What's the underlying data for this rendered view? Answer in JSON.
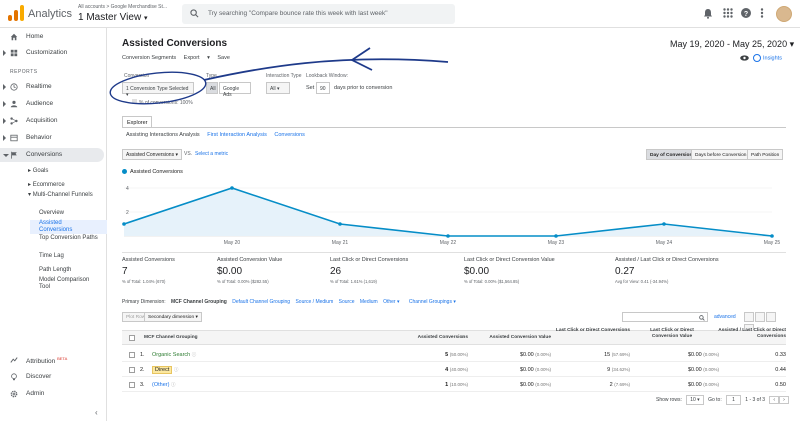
{
  "header": {
    "app_title": "Analytics",
    "account_path": "All accounts > Google Merchandise St...",
    "view_name": "1 Master View",
    "search_placeholder": "Try searching \"Compare bounce rate this week with last week\"",
    "logo_colors": [
      "#f9ab00",
      "#e37400",
      "#e37400"
    ]
  },
  "sidebar": {
    "items": [
      {
        "label": "Home",
        "icon": "home-icon"
      },
      {
        "label": "Customization",
        "icon": "grid-icon"
      },
      {
        "label": "Realtime",
        "icon": "clock-icon"
      },
      {
        "label": "Audience",
        "icon": "person-icon"
      },
      {
        "label": "Acquisition",
        "icon": "acquisition-icon"
      },
      {
        "label": "Behavior",
        "icon": "behavior-icon"
      },
      {
        "label": "Conversions",
        "icon": "flag-icon"
      }
    ],
    "reports_label": "REPORTS",
    "conversions_sub": {
      "goals": "Goals",
      "ecommerce": "Ecommerce",
      "mcf": "Multi-Channel Funnels",
      "overview": "Overview",
      "assisted": "Assisted Conversions",
      "top_paths": "Top Conversion Paths",
      "time_lag": "Time Lag",
      "path_length": "Path Length",
      "model_comp": "Model Comparison Tool"
    },
    "bottom": [
      {
        "label": "Attribution",
        "badge": "BETA",
        "icon": "attribution-icon"
      },
      {
        "label": "Discover",
        "icon": "bulb-icon"
      },
      {
        "label": "Admin",
        "icon": "gear-icon"
      }
    ]
  },
  "main": {
    "title": "Assisted Conversions",
    "date_range": "May 19, 2020 - May 25, 2020",
    "toolbar": [
      "Conversion Segments",
      "Export",
      "Save"
    ],
    "insights_label": "Insights",
    "filters": {
      "conversion_label": "Conversion",
      "conversion_value": "1 Conversion Type Selected",
      "pct_conv_label": "% of conversions: 100%",
      "type_label": "Type",
      "type_all": "All",
      "type_ads": "Google Ads",
      "interaction_label": "Interaction Type",
      "interaction_value": "All",
      "lookback_label": "Lookback Window:",
      "lookback_set": "Set",
      "lookback_days": "90",
      "lookback_suffix": "days prior to conversion"
    },
    "explorer_tab": "Explorer",
    "subtabs": [
      "Assisting Interactions Analysis",
      "First Interaction Analysis",
      "Conversions"
    ],
    "metric_selector": "Assisted Conversions",
    "vs": "VS.",
    "select_metric": "Select a metric",
    "segment_buttons": [
      "Day of Conversion",
      "Days before Conversion",
      "Path Position"
    ]
  },
  "chart_data": {
    "type": "line",
    "series": [
      {
        "name": "Assisted Conversions",
        "values": [
          1,
          4,
          1,
          0,
          0,
          1,
          0
        ]
      }
    ],
    "categories": [
      "",
      "May 20",
      "May 21",
      "May 22",
      "May 23",
      "May 24",
      "May 25"
    ],
    "yticks": [
      "4",
      "2"
    ],
    "ylim": [
      0,
      4.5
    ],
    "color": "#058dc7"
  },
  "stats": [
    {
      "title": "Assisted Conversions",
      "value": "7",
      "sub": "% of Total: 1.04% (670)"
    },
    {
      "title": "Assisted Conversion Value",
      "value": "$0.00",
      "sub": "% of Total: 0.00% ($282.55)"
    },
    {
      "title": "Last Click or Direct Conversions",
      "value": "26",
      "sub": "% of Total: 1.61% (1,619)"
    },
    {
      "title": "Last Click or Direct Conversion Value",
      "value": "$0.00",
      "sub": "% of Total: 0.00% ($1,564.85)"
    },
    {
      "title": "Assisted / Last Click or Direct Conversions",
      "value": "0.27",
      "sub": "Avg for View: 0.41 (-34.94%)"
    }
  ],
  "dimensions": {
    "label": "Primary Dimension:",
    "current": "MCF Channel Grouping",
    "links": [
      "Default Channel Grouping",
      "Source / Medium",
      "Source",
      "Medium",
      "Other",
      "Channel Groupings"
    ]
  },
  "table_ctrl": {
    "plot_rows": "Plot Rows",
    "secondary_dim": "Secondary dimension",
    "advanced": "advanced"
  },
  "table": {
    "headers": [
      "MCF Channel Grouping",
      "Assisted Conversions",
      "Assisted Conversion Value",
      "Last Click or Direct Conversions",
      "Last Click or Direct Conversion Value",
      "Assisted / Last Click or Direct Conversions"
    ],
    "rows": [
      {
        "idx": "1.",
        "name": "Organic Search",
        "ac": "5",
        "ac_pct": "(50.00%)",
        "acv": "$0.00",
        "acv_pct": "(0.00%)",
        "lc": "15",
        "lc_pct": "(57.69%)",
        "lcv": "$0.00",
        "lcv_pct": "(0.00%)",
        "ratio": "0.33"
      },
      {
        "idx": "2.",
        "name": "Direct",
        "ac": "4",
        "ac_pct": "(40.00%)",
        "acv": "$0.00",
        "acv_pct": "(0.00%)",
        "lc": "9",
        "lc_pct": "(34.62%)",
        "lcv": "$0.00",
        "lcv_pct": "(0.00%)",
        "ratio": "0.44"
      },
      {
        "idx": "3.",
        "name": "(Other)",
        "ac": "1",
        "ac_pct": "(10.00%)",
        "acv": "$0.00",
        "acv_pct": "(0.00%)",
        "lc": "2",
        "lc_pct": "(7.69%)",
        "lcv": "$0.00",
        "lcv_pct": "(0.00%)",
        "ratio": "0.50"
      }
    ]
  },
  "pager": {
    "show_rows": "Show rows:",
    "rows": "10",
    "goto": "Go to:",
    "page": "1",
    "range": "1 - 3 of 3"
  }
}
